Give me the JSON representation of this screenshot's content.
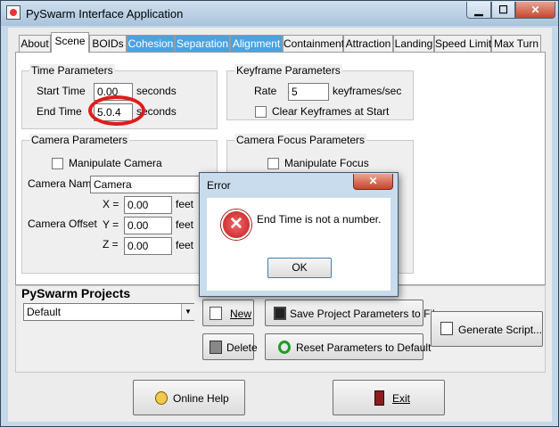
{
  "window": {
    "title": "PySwarm Interface Application",
    "min": "▁",
    "max": "☐",
    "close": "✕"
  },
  "tabs": [
    "About",
    "Scene",
    "BOIDs",
    "Cohesion",
    "Separation",
    "Alignment",
    "Containment",
    "Attraction",
    "Landing",
    "Speed Limit",
    "Max Turn"
  ],
  "time": {
    "title": "Time Parameters",
    "start_label": "Start Time",
    "start_value": "0.00",
    "start_unit": "seconds",
    "end_label": "End Time",
    "end_value": "5.0.4",
    "end_unit": "seconds"
  },
  "keyframe": {
    "title": "Keyframe Parameters",
    "rate_label": "Rate",
    "rate_value": "5",
    "rate_unit": "keyframes/sec",
    "clear_label": "Clear Keyframes at Start"
  },
  "camera": {
    "title": "Camera Parameters",
    "manipulate_label": "Manipulate Camera",
    "name_label": "Camera Name",
    "name_value": "Camera",
    "offset_label": "Camera Offset",
    "x_label": "X =",
    "x_value": "0.00",
    "y_label": "Y =",
    "y_value": "0.00",
    "z_label": "Z =",
    "z_value": "0.00",
    "unit": "feet"
  },
  "focus": {
    "title": "Camera Focus Parameters",
    "manipulate_label": "Manipulate Focus"
  },
  "projects": {
    "title": "PySwarm Projects",
    "selected": "Default",
    "new": "New",
    "delete": "Delete",
    "save": "Save Project Parameters to File",
    "reset": "Reset Parameters to Default",
    "generate": "Generate Script..."
  },
  "footer": {
    "help": "Online Help",
    "exit": "Exit"
  },
  "dialog": {
    "title": "Error",
    "message": "End Time is not a number.",
    "ok": "OK",
    "close": "✕"
  },
  "colors": {
    "highlight_tab": "#4aa3e0",
    "error_red": "#e01b1b",
    "window_frame": "#c4d8ea"
  }
}
